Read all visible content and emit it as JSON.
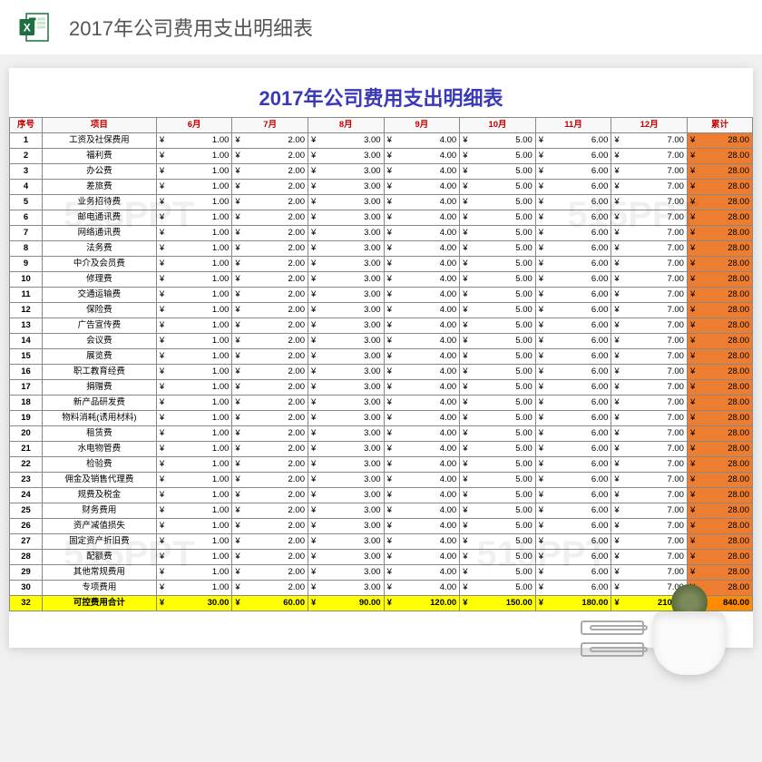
{
  "page_title": "2017年公司费用支出明细表",
  "sheet_title": "2017年公司费用支出明细表",
  "watermark": "515PPT",
  "headers": [
    "序号",
    "项目",
    "6月",
    "7月",
    "8月",
    "9月",
    "10月",
    "11月",
    "12月",
    "累计"
  ],
  "currency": "¥",
  "rows": [
    {
      "seq": "1",
      "item": "工资及社保费用",
      "v": [
        "1.00",
        "2.00",
        "3.00",
        "4.00",
        "5.00",
        "6.00",
        "7.00"
      ],
      "sum": "28.00"
    },
    {
      "seq": "2",
      "item": "福利费",
      "v": [
        "1.00",
        "2.00",
        "3.00",
        "4.00",
        "5.00",
        "6.00",
        "7.00"
      ],
      "sum": "28.00"
    },
    {
      "seq": "3",
      "item": "办公费",
      "v": [
        "1.00",
        "2.00",
        "3.00",
        "4.00",
        "5.00",
        "6.00",
        "7.00"
      ],
      "sum": "28.00"
    },
    {
      "seq": "4",
      "item": "差旅费",
      "v": [
        "1.00",
        "2.00",
        "3.00",
        "4.00",
        "5.00",
        "6.00",
        "7.00"
      ],
      "sum": "28.00"
    },
    {
      "seq": "5",
      "item": "业务招待费",
      "v": [
        "1.00",
        "2.00",
        "3.00",
        "4.00",
        "5.00",
        "6.00",
        "7.00"
      ],
      "sum": "28.00"
    },
    {
      "seq": "6",
      "item": "邮电通讯费",
      "v": [
        "1.00",
        "2.00",
        "3.00",
        "4.00",
        "5.00",
        "6.00",
        "7.00"
      ],
      "sum": "28.00"
    },
    {
      "seq": "7",
      "item": "网络通讯费",
      "v": [
        "1.00",
        "2.00",
        "3.00",
        "4.00",
        "5.00",
        "6.00",
        "7.00"
      ],
      "sum": "28.00"
    },
    {
      "seq": "8",
      "item": "法务费",
      "v": [
        "1.00",
        "2.00",
        "3.00",
        "4.00",
        "5.00",
        "6.00",
        "7.00"
      ],
      "sum": "28.00"
    },
    {
      "seq": "9",
      "item": "中介及会员费",
      "v": [
        "1.00",
        "2.00",
        "3.00",
        "4.00",
        "5.00",
        "6.00",
        "7.00"
      ],
      "sum": "28.00"
    },
    {
      "seq": "10",
      "item": "修理费",
      "v": [
        "1.00",
        "2.00",
        "3.00",
        "4.00",
        "5.00",
        "6.00",
        "7.00"
      ],
      "sum": "28.00"
    },
    {
      "seq": "11",
      "item": "交通运输费",
      "v": [
        "1.00",
        "2.00",
        "3.00",
        "4.00",
        "5.00",
        "6.00",
        "7.00"
      ],
      "sum": "28.00"
    },
    {
      "seq": "12",
      "item": "保险费",
      "v": [
        "1.00",
        "2.00",
        "3.00",
        "4.00",
        "5.00",
        "6.00",
        "7.00"
      ],
      "sum": "28.00"
    },
    {
      "seq": "13",
      "item": "广告宣传费",
      "v": [
        "1.00",
        "2.00",
        "3.00",
        "4.00",
        "5.00",
        "6.00",
        "7.00"
      ],
      "sum": "28.00"
    },
    {
      "seq": "14",
      "item": "会议费",
      "v": [
        "1.00",
        "2.00",
        "3.00",
        "4.00",
        "5.00",
        "6.00",
        "7.00"
      ],
      "sum": "28.00"
    },
    {
      "seq": "15",
      "item": "展览费",
      "v": [
        "1.00",
        "2.00",
        "3.00",
        "4.00",
        "5.00",
        "6.00",
        "7.00"
      ],
      "sum": "28.00"
    },
    {
      "seq": "16",
      "item": "职工教育经费",
      "v": [
        "1.00",
        "2.00",
        "3.00",
        "4.00",
        "5.00",
        "6.00",
        "7.00"
      ],
      "sum": "28.00"
    },
    {
      "seq": "17",
      "item": "捐赠费",
      "v": [
        "1.00",
        "2.00",
        "3.00",
        "4.00",
        "5.00",
        "6.00",
        "7.00"
      ],
      "sum": "28.00"
    },
    {
      "seq": "18",
      "item": "新产品研发费",
      "v": [
        "1.00",
        "2.00",
        "3.00",
        "4.00",
        "5.00",
        "6.00",
        "7.00"
      ],
      "sum": "28.00"
    },
    {
      "seq": "19",
      "item": "物料消耗(诱用材料)",
      "v": [
        "1.00",
        "2.00",
        "3.00",
        "4.00",
        "5.00",
        "6.00",
        "7.00"
      ],
      "sum": "28.00"
    },
    {
      "seq": "20",
      "item": "租赁费",
      "v": [
        "1.00",
        "2.00",
        "3.00",
        "4.00",
        "5.00",
        "6.00",
        "7.00"
      ],
      "sum": "28.00"
    },
    {
      "seq": "21",
      "item": "水电物管费",
      "v": [
        "1.00",
        "2.00",
        "3.00",
        "4.00",
        "5.00",
        "6.00",
        "7.00"
      ],
      "sum": "28.00"
    },
    {
      "seq": "22",
      "item": "检验费",
      "v": [
        "1.00",
        "2.00",
        "3.00",
        "4.00",
        "5.00",
        "6.00",
        "7.00"
      ],
      "sum": "28.00"
    },
    {
      "seq": "23",
      "item": "佣金及销售代理费",
      "v": [
        "1.00",
        "2.00",
        "3.00",
        "4.00",
        "5.00",
        "6.00",
        "7.00"
      ],
      "sum": "28.00"
    },
    {
      "seq": "24",
      "item": "规费及税金",
      "v": [
        "1.00",
        "2.00",
        "3.00",
        "4.00",
        "5.00",
        "6.00",
        "7.00"
      ],
      "sum": "28.00"
    },
    {
      "seq": "25",
      "item": "财务费用",
      "v": [
        "1.00",
        "2.00",
        "3.00",
        "4.00",
        "5.00",
        "6.00",
        "7.00"
      ],
      "sum": "28.00"
    },
    {
      "seq": "26",
      "item": "资产减值损失",
      "v": [
        "1.00",
        "2.00",
        "3.00",
        "4.00",
        "5.00",
        "6.00",
        "7.00"
      ],
      "sum": "28.00"
    },
    {
      "seq": "27",
      "item": "固定资产折旧费",
      "v": [
        "1.00",
        "2.00",
        "3.00",
        "4.00",
        "5.00",
        "6.00",
        "7.00"
      ],
      "sum": "28.00"
    },
    {
      "seq": "28",
      "item": "配额费",
      "v": [
        "1.00",
        "2.00",
        "3.00",
        "4.00",
        "5.00",
        "6.00",
        "7.00"
      ],
      "sum": "28.00"
    },
    {
      "seq": "29",
      "item": "其他常规费用",
      "v": [
        "1.00",
        "2.00",
        "3.00",
        "4.00",
        "5.00",
        "6.00",
        "7.00"
      ],
      "sum": "28.00"
    },
    {
      "seq": "30",
      "item": "专项费用",
      "v": [
        "1.00",
        "2.00",
        "3.00",
        "4.00",
        "5.00",
        "6.00",
        "7.00"
      ],
      "sum": "28.00"
    }
  ],
  "total_row": {
    "seq": "32",
    "item": "可控费用合计",
    "v": [
      "30.00",
      "60.00",
      "90.00",
      "120.00",
      "150.00",
      "180.00",
      "210.00"
    ],
    "sum": "840.00"
  }
}
